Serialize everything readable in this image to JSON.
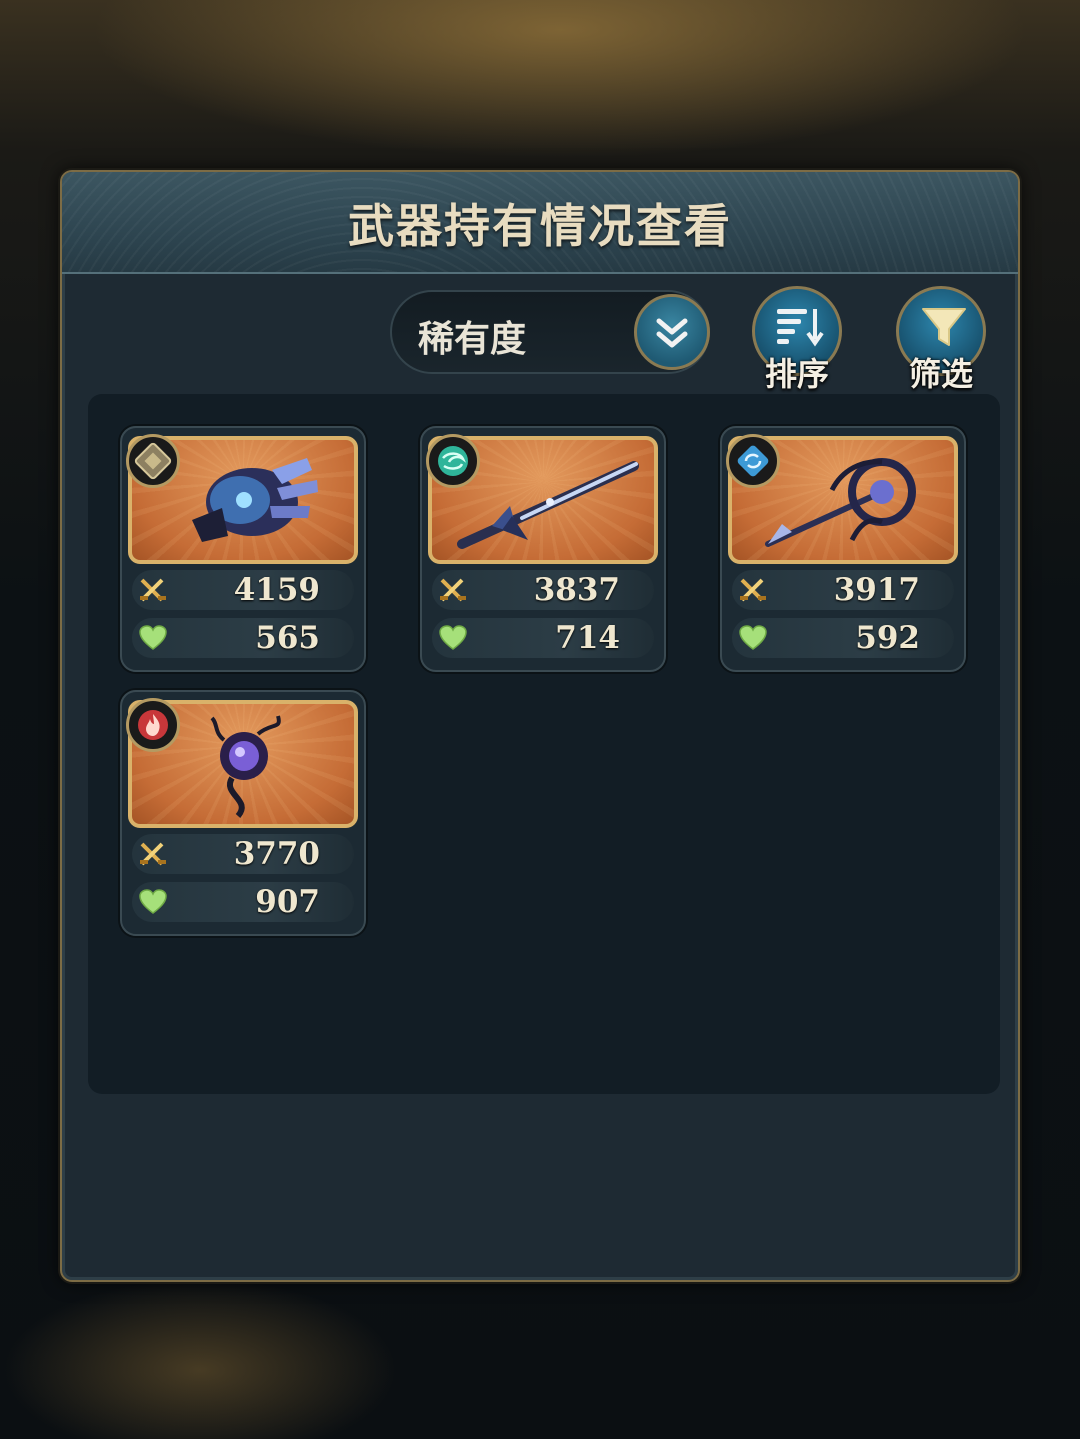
{
  "panel": {
    "title": "武器持有情况查看"
  },
  "toolbar": {
    "sort_dropdown_value": "稀有度",
    "sort_button_label": "排序",
    "filter_button_label": "筛选"
  },
  "weapons": [
    {
      "element": "earth",
      "element_icon": "earth-element-icon",
      "type": "gauntlet",
      "attack": "4159",
      "hp": "565"
    },
    {
      "element": "wind",
      "element_icon": "wind-element-icon",
      "type": "sword",
      "attack": "3837",
      "hp": "714"
    },
    {
      "element": "water",
      "element_icon": "water-element-icon",
      "type": "staff",
      "attack": "3917",
      "hp": "592"
    },
    {
      "element": "fire",
      "element_icon": "fire-element-icon",
      "type": "orb",
      "attack": "3770",
      "hp": "907"
    }
  ],
  "colors": {
    "rarity_frame": "#d9b26a",
    "card_background": "#c56c36",
    "accent_button": "#2d86ad",
    "hp_icon": "#a6e07a",
    "attack_icon": "#e0b050"
  }
}
